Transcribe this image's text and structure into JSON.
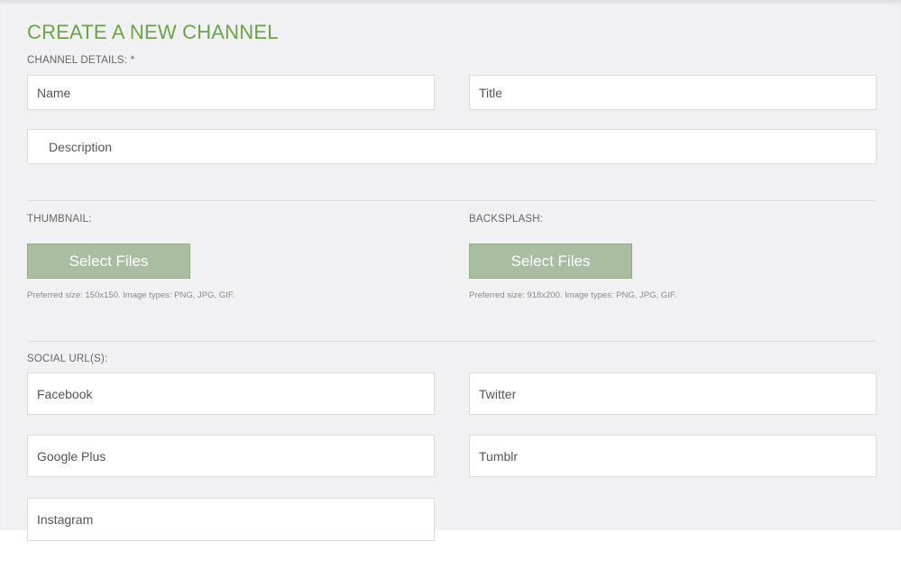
{
  "page": {
    "title": "CREATE A NEW CHANNEL"
  },
  "channel_details": {
    "label": "CHANNEL DETAILS: *",
    "name_placeholder": "Name",
    "title_placeholder": "Title",
    "description_placeholder": "Description"
  },
  "thumbnail": {
    "label": "THUMBNAIL:",
    "button_label": "Select Files",
    "hint": "Preferred size: 150x150. Image types: PNG, JPG, GIF."
  },
  "backsplash": {
    "label": "BACKSPLASH:",
    "button_label": "Select Files",
    "hint": "Preferred size: 918x200. Image types: PNG, JPG, GIF."
  },
  "social": {
    "label": "SOCIAL URL(S):",
    "facebook_placeholder": "Facebook",
    "twitter_placeholder": "Twitter",
    "googleplus_placeholder": "Google Plus",
    "tumblr_placeholder": "Tumblr",
    "instagram_placeholder": "Instagram"
  },
  "colors": {
    "title_green": "#6aa544",
    "button_green": "#a9bea0",
    "panel_bg": "#f1f1f4"
  }
}
